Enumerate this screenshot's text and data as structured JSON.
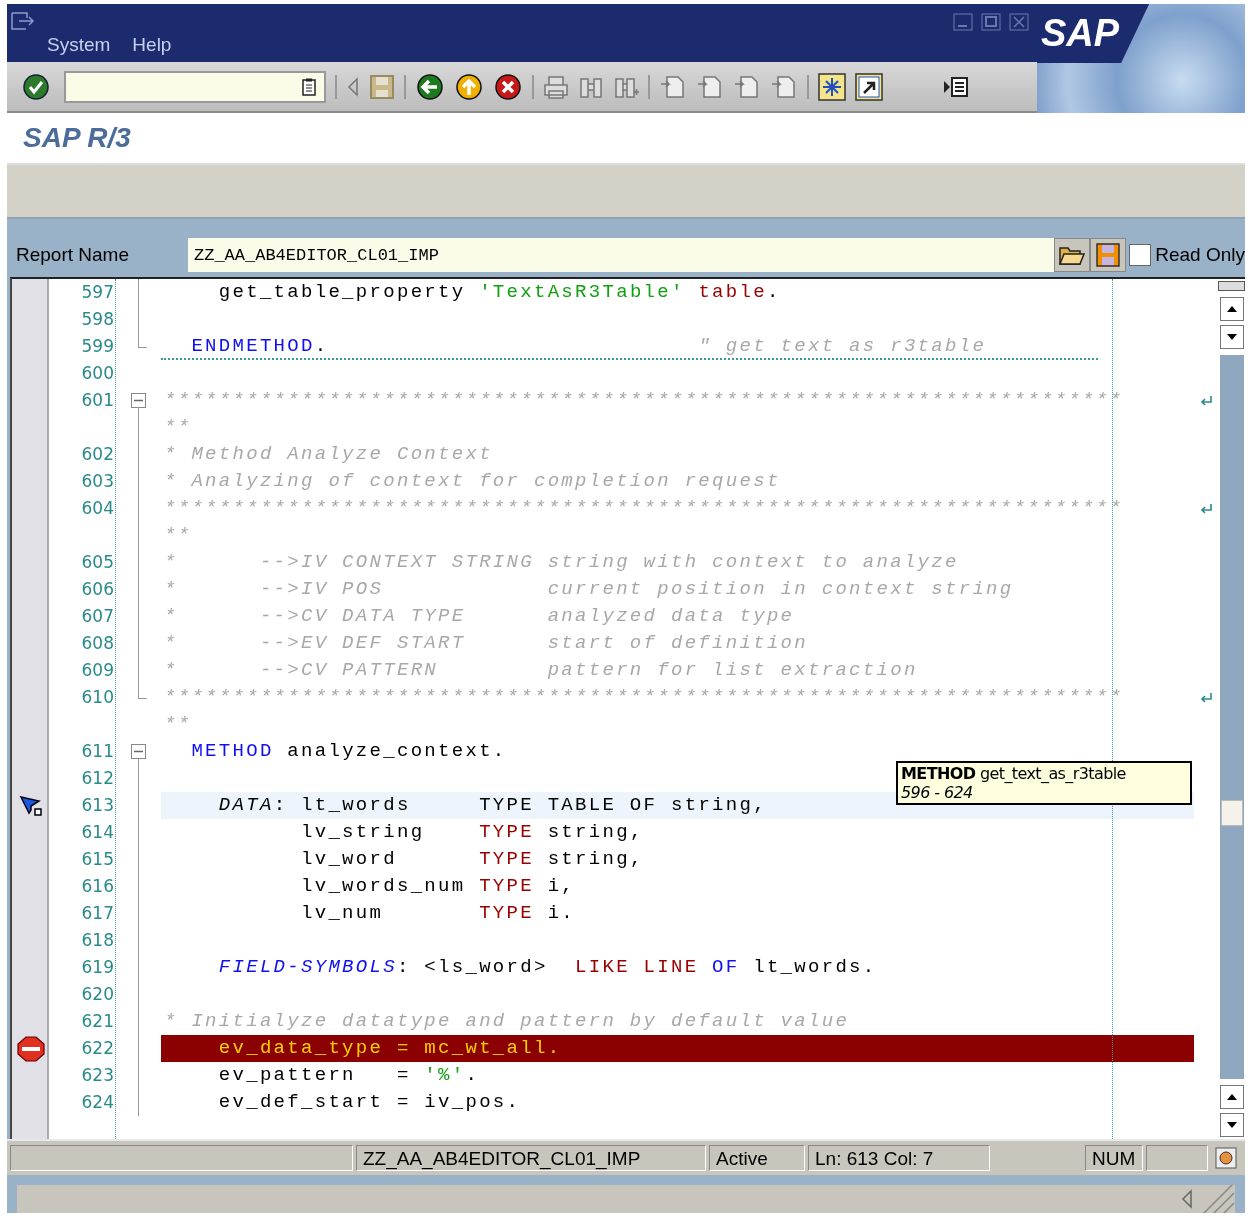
{
  "menu": [
    {
      "label": "System"
    },
    {
      "label": "Help"
    }
  ],
  "logo": "SAP",
  "title": "SAP R/3",
  "report": {
    "label": "Report Name",
    "value": "ZZ_AA_AB4EDITOR_CL01_IMP",
    "read_only": {
      "label": "Read Only",
      "checked": false
    }
  },
  "editor": {
    "lines": [
      {
        "number": "597",
        "foldable": false,
        "block_end": false,
        "separator": false,
        "bookmark": false,
        "breakpoint": false,
        "current_line": false,
        "tokens": [
          {
            "kind": "plain",
            "text": "    get_table_property "
          },
          {
            "kind": "string",
            "text": "'TextAsR3Table' "
          },
          {
            "kind": "keyword_red",
            "text": "table"
          },
          {
            "kind": "plain",
            "text": "."
          }
        ]
      },
      {
        "number": "598",
        "foldable": false,
        "block_end": false,
        "separator": false,
        "bookmark": false,
        "breakpoint": false,
        "current_line": false
      },
      {
        "number": "599",
        "foldable": false,
        "block_end": true,
        "separator": true,
        "bookmark": false,
        "breakpoint": false,
        "current_line": false,
        "tokens": [
          {
            "kind": "keyword",
            "text": "  ENDMETHOD"
          },
          {
            "kind": "plain",
            "text": ".                           "
          },
          {
            "kind": "comment",
            "text": "\" get text as r3table"
          }
        ]
      },
      {
        "number": "600",
        "foldable": false,
        "block_end": false,
        "separator": false,
        "bookmark": false,
        "breakpoint": false,
        "current_line": false
      },
      {
        "number": "601",
        "foldable": true,
        "block_end": false,
        "separator": false,
        "bookmark": false,
        "breakpoint": false,
        "current_line": false,
        "tokens": [
          {
            "kind": "comment",
            "text": "**********************************************************************"
          }
        ],
        "wrapped": [
          {
            "kind": "comment",
            "text": "**"
          }
        ]
      },
      {
        "number": "602",
        "foldable": false,
        "block_end": false,
        "separator": false,
        "bookmark": false,
        "breakpoint": false,
        "current_line": false,
        "tokens": [
          {
            "kind": "comment",
            "text": "* Method Analyze Context"
          }
        ]
      },
      {
        "number": "603",
        "foldable": false,
        "block_end": false,
        "separator": false,
        "bookmark": false,
        "breakpoint": false,
        "current_line": false,
        "tokens": [
          {
            "kind": "comment",
            "text": "* Analyzing of context for completion request"
          }
        ]
      },
      {
        "number": "604",
        "foldable": false,
        "block_end": false,
        "separator": false,
        "bookmark": false,
        "breakpoint": false,
        "current_line": false,
        "tokens": [
          {
            "kind": "comment",
            "text": "**********************************************************************"
          }
        ],
        "wrapped": [
          {
            "kind": "comment",
            "text": "**"
          }
        ]
      },
      {
        "number": "605",
        "foldable": false,
        "block_end": false,
        "separator": false,
        "bookmark": false,
        "breakpoint": false,
        "current_line": false,
        "tokens": [
          {
            "kind": "comment",
            "text": "*      -->IV CONTEXT STRING string with context to analyze"
          }
        ]
      },
      {
        "number": "606",
        "foldable": false,
        "block_end": false,
        "separator": false,
        "bookmark": false,
        "breakpoint": false,
        "current_line": false,
        "tokens": [
          {
            "kind": "comment",
            "text": "*      -->IV POS            current position in context string"
          }
        ]
      },
      {
        "number": "607",
        "foldable": false,
        "block_end": false,
        "separator": false,
        "bookmark": false,
        "breakpoint": false,
        "current_line": false,
        "tokens": [
          {
            "kind": "comment",
            "text": "*      -->CV DATA TYPE      analyzed data type"
          }
        ]
      },
      {
        "number": "608",
        "foldable": false,
        "block_end": false,
        "separator": false,
        "bookmark": false,
        "breakpoint": false,
        "current_line": false,
        "tokens": [
          {
            "kind": "comment",
            "text": "*      -->EV DEF START      start of definition"
          }
        ]
      },
      {
        "number": "609",
        "foldable": false,
        "block_end": false,
        "separator": false,
        "bookmark": false,
        "breakpoint": false,
        "current_line": false,
        "tokens": [
          {
            "kind": "comment",
            "text": "*      -->CV PATTERN        pattern for list extraction"
          }
        ]
      },
      {
        "number": "610",
        "foldable": false,
        "block_end": true,
        "separator": false,
        "bookmark": false,
        "breakpoint": false,
        "current_line": false,
        "tokens": [
          {
            "kind": "comment",
            "text": "**********************************************************************"
          }
        ],
        "wrapped": [
          {
            "kind": "comment",
            "text": "**"
          }
        ]
      },
      {
        "number": "611",
        "foldable": true,
        "block_end": false,
        "separator": false,
        "bookmark": false,
        "breakpoint": false,
        "current_line": false,
        "tokens": [
          {
            "kind": "keyword",
            "text": "  METHOD"
          },
          {
            "kind": "plain",
            "text": " analyze_context."
          }
        ]
      },
      {
        "number": "612",
        "foldable": false,
        "block_end": false,
        "separator": false,
        "bookmark": false,
        "breakpoint": false,
        "current_line": false
      },
      {
        "number": "613",
        "foldable": false,
        "block_end": false,
        "separator": false,
        "bookmark": true,
        "breakpoint": false,
        "current_line": true,
        "tokens": [
          {
            "kind": "declaration",
            "text": "    DATA"
          },
          {
            "kind": "plain",
            "text": ": lt_words     TYPE TABLE OF string,"
          }
        ]
      },
      {
        "number": "614",
        "foldable": false,
        "block_end": false,
        "separator": false,
        "bookmark": false,
        "breakpoint": false,
        "current_line": false,
        "tokens": [
          {
            "kind": "plain",
            "text": "          lv_string    "
          },
          {
            "kind": "keyword_red",
            "text": "TYPE"
          },
          {
            "kind": "plain",
            "text": " string,"
          }
        ]
      },
      {
        "number": "615",
        "foldable": false,
        "block_end": false,
        "separator": false,
        "bookmark": false,
        "breakpoint": false,
        "current_line": false,
        "tokens": [
          {
            "kind": "plain",
            "text": "          lv_word      "
          },
          {
            "kind": "keyword_red",
            "text": "TYPE"
          },
          {
            "kind": "plain",
            "text": " string,"
          }
        ]
      },
      {
        "number": "616",
        "foldable": false,
        "block_end": false,
        "separator": false,
        "bookmark": false,
        "breakpoint": false,
        "current_line": false,
        "tokens": [
          {
            "kind": "plain",
            "text": "          lv_words_num "
          },
          {
            "kind": "keyword_red",
            "text": "TYPE"
          },
          {
            "kind": "plain",
            "text": " i,"
          }
        ]
      },
      {
        "number": "617",
        "foldable": false,
        "block_end": false,
        "separator": false,
        "bookmark": false,
        "breakpoint": false,
        "current_line": false,
        "tokens": [
          {
            "kind": "plain",
            "text": "          lv_num       "
          },
          {
            "kind": "keyword_red",
            "text": "TYPE"
          },
          {
            "kind": "plain",
            "text": " i."
          }
        ]
      },
      {
        "number": "618",
        "foldable": false,
        "block_end": false,
        "separator": false,
        "bookmark": false,
        "breakpoint": false,
        "current_line": false
      },
      {
        "number": "619",
        "foldable": false,
        "block_end": false,
        "separator": false,
        "bookmark": false,
        "breakpoint": false,
        "current_line": false,
        "tokens": [
          {
            "kind": "keyword_italic",
            "text": "    FIELD-SYMBOLS"
          },
          {
            "kind": "plain",
            "text": ": <ls_word>  "
          },
          {
            "kind": "keyword_red",
            "text": "LIKE LINE "
          },
          {
            "kind": "keyword",
            "text": "OF"
          },
          {
            "kind": "plain",
            "text": " lt_words."
          }
        ]
      },
      {
        "number": "620",
        "foldable": false,
        "block_end": false,
        "separator": false,
        "bookmark": false,
        "breakpoint": false,
        "current_line": false
      },
      {
        "number": "621",
        "foldable": false,
        "block_end": false,
        "separator": false,
        "bookmark": false,
        "breakpoint": false,
        "current_line": false,
        "tokens": [
          {
            "kind": "comment",
            "text": "* Initialyze datatype and pattern by default value"
          }
        ]
      },
      {
        "number": "622",
        "foldable": false,
        "block_end": false,
        "separator": false,
        "bookmark": false,
        "breakpoint": true,
        "current_line": false,
        "tokens": [
          {
            "kind": "plain",
            "text": "    ev_data_type = mc_wt_all."
          }
        ]
      },
      {
        "number": "623",
        "foldable": false,
        "block_end": false,
        "separator": false,
        "bookmark": false,
        "breakpoint": false,
        "current_line": false,
        "tokens": [
          {
            "kind": "plain",
            "text": "    ev_pattern   = "
          },
          {
            "kind": "string",
            "text": "'%'"
          },
          {
            "kind": "plain",
            "text": "."
          }
        ]
      },
      {
        "number": "624",
        "foldable": false,
        "block_end": false,
        "separator": false,
        "bookmark": false,
        "breakpoint": false,
        "current_line": false,
        "tokens": [
          {
            "kind": "plain",
            "text": "    ev_def_start = iv_pos."
          }
        ]
      }
    ],
    "tooltip": {
      "heading": "**METHOD** get_text_as_r3table",
      "range": "596 - 624"
    }
  },
  "status_bar": {
    "fields": [
      "ZZ_AA_AB4EDITOR_CL01_IMP",
      "Active",
      "Ln: 613 Col: 7",
      "NUM"
    ]
  }
}
